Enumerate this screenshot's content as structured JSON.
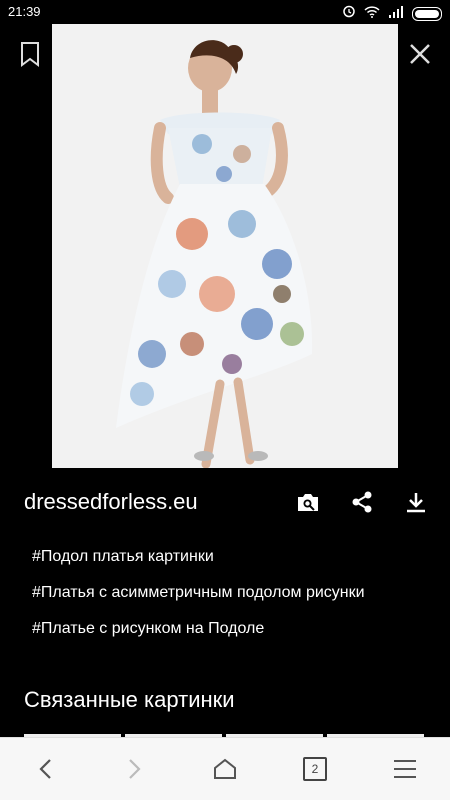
{
  "status_bar": {
    "time": "21:39"
  },
  "image": {
    "alt_subject": "floral high-low off-shoulder dress"
  },
  "source": {
    "domain": "dressedforless.eu"
  },
  "tags": [
    "#Подол платья картинки",
    "#Платья с асимметричным подолом рисунки",
    "#Платье с рисунком на Подоле"
  ],
  "related": {
    "title": "Связанные картинки"
  },
  "bottom_nav": {
    "tab_count": "2"
  },
  "colors": {
    "background": "#000000",
    "bar": "#f7f7f7"
  }
}
